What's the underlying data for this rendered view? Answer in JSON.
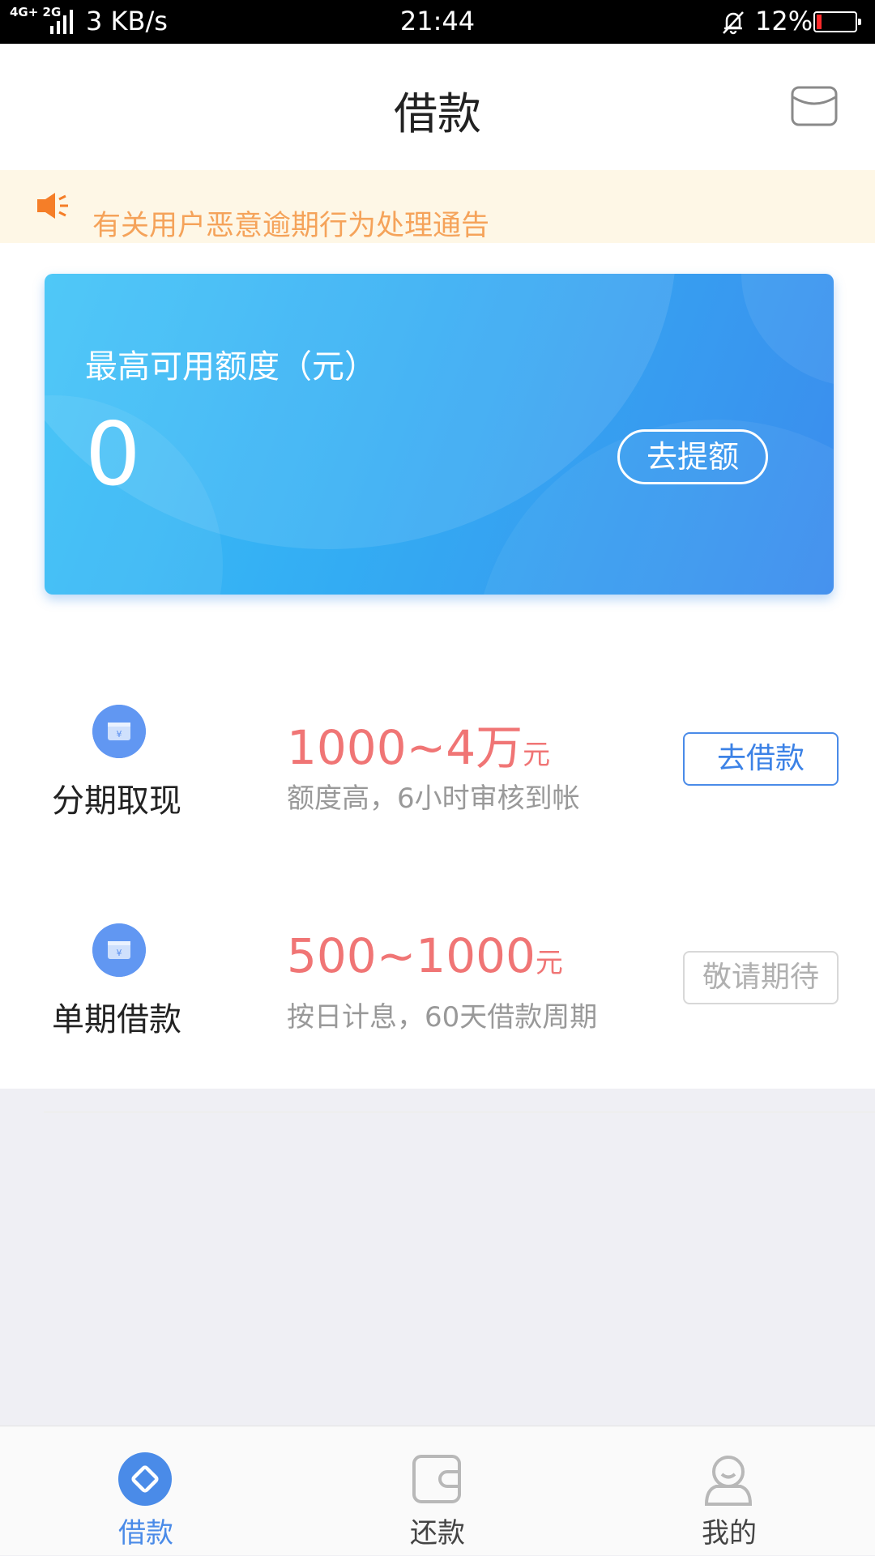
{
  "status_bar": {
    "network": "4G+ 2G",
    "speed": "3 KB/s",
    "time": "21:44",
    "battery": "12%",
    "battery_level": 0.12,
    "battery_color": "#ff2a2a"
  },
  "header": {
    "title": "借款",
    "mail_icon": "mail-icon"
  },
  "notice": {
    "icon": "speaker-icon",
    "text": "有关用户恶意逾期行为处理通告"
  },
  "credit_card": {
    "label": "最高可用额度（元）",
    "amount": "0",
    "button": "去提额"
  },
  "products": [
    {
      "icon": "wallet-icon",
      "name": "分期取现",
      "range": "1000~4万",
      "unit": "元",
      "desc": "额度高，6小时审核到帐",
      "action": "去借款",
      "enabled": true
    },
    {
      "icon": "wallet-icon",
      "name": "单期借款",
      "range": "500~1000",
      "unit": "元",
      "desc": "按日计息，60天借款周期",
      "action": "敬请期待",
      "enabled": false
    }
  ],
  "tabbar": {
    "tabs": [
      {
        "label": "借款",
        "icon": "diamond-icon",
        "active": true
      },
      {
        "label": "还款",
        "icon": "wallet-tab-icon",
        "active": false
      },
      {
        "label": "我的",
        "icon": "user-icon",
        "active": false
      }
    ]
  },
  "colors": {
    "accent": "#4a8be8",
    "price": "#f07575",
    "notice_text": "#f5a35a",
    "notice_bg": "#fef7e6"
  }
}
